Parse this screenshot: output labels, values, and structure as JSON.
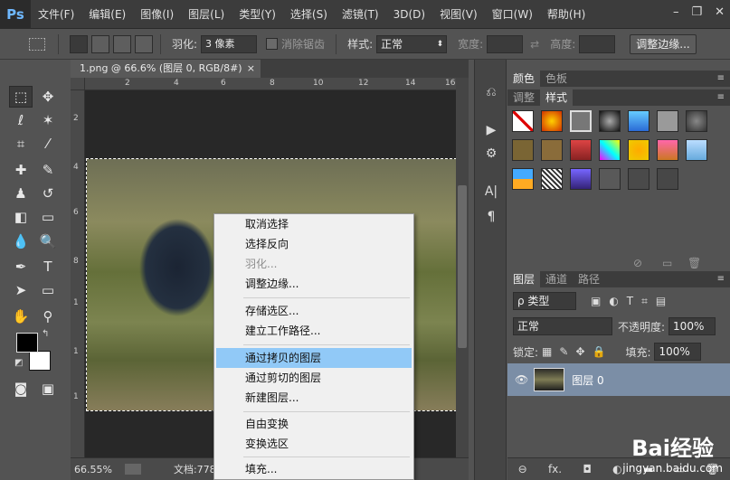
{
  "app": {
    "logo": "Ps"
  },
  "menu": [
    "文件(F)",
    "编辑(E)",
    "图像(I)",
    "图层(L)",
    "类型(Y)",
    "选择(S)",
    "滤镜(T)",
    "3D(D)",
    "视图(V)",
    "窗口(W)",
    "帮助(H)"
  ],
  "window_controls": {
    "minimize": "–",
    "restore": "❐",
    "close": "✕"
  },
  "options": {
    "feather_label": "羽化:",
    "feather_value": "3 像素",
    "antialias_label": "消除锯齿",
    "style_label": "样式:",
    "style_value": "正常",
    "width_label": "宽度:",
    "height_label": "高度:",
    "refine_button": "调整边缘..."
  },
  "document": {
    "tab_title": "1.png @ 66.6% (图层 0, RGB/8#)",
    "close": "×",
    "ruler_h": [
      "2",
      "4",
      "6",
      "8",
      "10",
      "12",
      "14",
      "16"
    ],
    "ruler_v": [
      "2",
      "4",
      "6",
      "8",
      "1",
      "1",
      "1"
    ],
    "zoom": "66.55%",
    "doc_info": "文档:778.3"
  },
  "panels": {
    "color_tabs": [
      "颜色",
      "色板"
    ],
    "style_tabs": [
      "调整",
      "样式"
    ],
    "layer_tabs": [
      "图层",
      "通道",
      "路径"
    ],
    "kind_label": "ρ 类型",
    "blend_mode": "正常",
    "opacity_label": "不透明度:",
    "opacity_value": "100%",
    "lock_label": "锁定:",
    "fill_label": "填充:",
    "fill_value": "100%",
    "layer_name": "图层 0",
    "footer_icons": [
      "⊖",
      "fx.",
      "◘",
      "◐",
      "▬",
      "▭",
      "🗑"
    ]
  },
  "context_menu": {
    "items": [
      {
        "label": "取消选择",
        "state": "normal"
      },
      {
        "label": "选择反向",
        "state": "normal"
      },
      {
        "label": "羽化...",
        "state": "disabled"
      },
      {
        "label": "调整边缘...",
        "state": "normal"
      },
      {
        "label": "存储选区...",
        "state": "normal"
      },
      {
        "label": "建立工作路径...",
        "state": "normal"
      },
      {
        "label": "通过拷贝的图层",
        "state": "highlighted"
      },
      {
        "label": "通过剪切的图层",
        "state": "normal"
      },
      {
        "label": "新建图层...",
        "state": "normal"
      },
      {
        "label": "自由变换",
        "state": "normal"
      },
      {
        "label": "变换选区",
        "state": "normal"
      },
      {
        "label": "填充...",
        "state": "normal"
      }
    ]
  },
  "watermark": {
    "logo": "Bai经验",
    "url": "jingyan.baidu.com"
  },
  "colors": {
    "highlight": "#91c9f7",
    "layer_selected": "#7b8ea6",
    "logo_blue": "#6fb8ff"
  }
}
